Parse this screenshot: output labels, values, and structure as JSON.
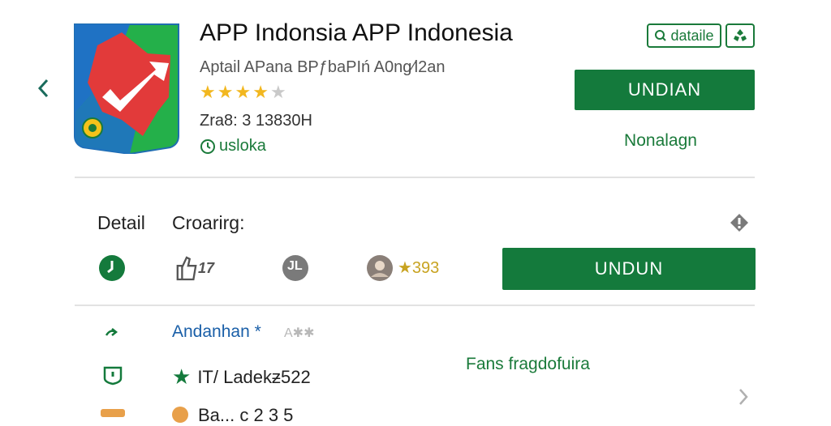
{
  "header": {
    "back_icon": "chevron-left-icon",
    "title": "APP Indonsia APP Indonesia",
    "subtitle": "Aptail APana BPƒbaPIń A0ng∕l2an",
    "rating_value": 3.5,
    "rating_max": 5,
    "size_text": "Zra8: 3 13830H",
    "developer_label": "usloka",
    "detail_chip_label": "dataile",
    "share_icon": "share-icon",
    "install_label": "UNDIAN",
    "secondary_label": "Nonalagn"
  },
  "details": {
    "title": "Detail",
    "creator_label": "Croarirg:",
    "info_icon": "info-icon",
    "stat_icons": [
      "clock-icon",
      "thumbs-up-icon",
      "share-circle-icon",
      "avatar-icon"
    ],
    "stat_thumb_text": "17",
    "stat_share_text": "JL",
    "rating_text": "★393",
    "download_label": "UNDUN"
  },
  "rows": {
    "row1_link": "Andanhan *",
    "row1_faint": "A✱✱",
    "row2_star": "★",
    "row2_text": "IT/ Ladekƶ522",
    "row3_text": "Ba...  c 2 3 5",
    "fans_text": "Fans fragdofuira"
  },
  "colors": {
    "green": "#147a3c",
    "link_blue": "#1a5fa8",
    "star_gold": "#f2b71f"
  }
}
